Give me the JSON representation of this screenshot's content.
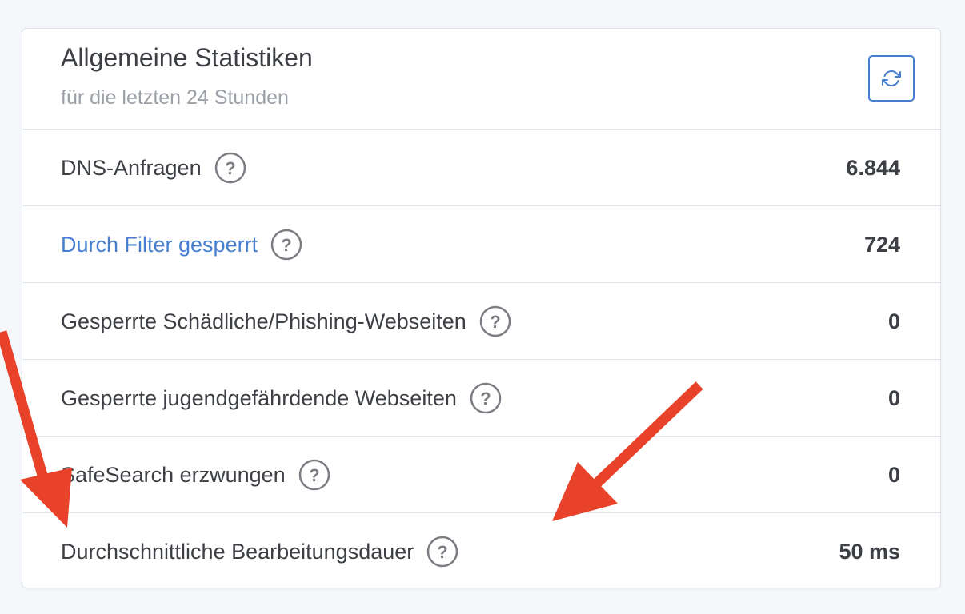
{
  "card": {
    "title": "Allgemeine Statistiken",
    "subtitle": "für die letzten 24 Stunden",
    "refresh_icon": "refresh-icon",
    "rows": [
      {
        "label": "DNS-Anfragen",
        "value": "6.844",
        "is_link": false
      },
      {
        "label": "Durch Filter gesperrt",
        "value": "724",
        "is_link": true
      },
      {
        "label": "Gesperrte Schädliche/Phishing-Webseiten",
        "value": "0",
        "is_link": false
      },
      {
        "label": "Gesperrte jugendgefährdende Webseiten",
        "value": "0",
        "is_link": false
      },
      {
        "label": "SafeSearch erzwungen",
        "value": "0",
        "is_link": false
      },
      {
        "label": "Durchschnittliche Bearbeitungsdauer",
        "value": "50 ms",
        "is_link": false
      }
    ]
  },
  "colors": {
    "accent": "#467fcf",
    "text": "#3c3f44",
    "muted": "#9aa0a6",
    "annotation_arrow": "#e8432a"
  },
  "icons": {
    "help": "question-circle-icon",
    "refresh": "refresh-icon",
    "annotation": "arrow-annotation"
  }
}
